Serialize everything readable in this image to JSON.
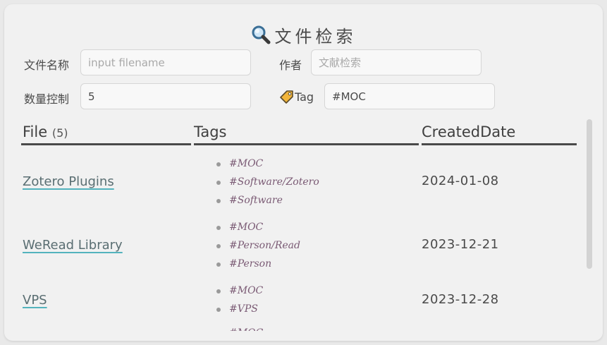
{
  "search": {
    "title": "文件检索",
    "filename_label": "文件名称",
    "filename_placeholder": "input filename",
    "filename_value": "",
    "author_label": "作者",
    "author_placeholder": "文献检索",
    "author_value": "",
    "count_label": "数量控制",
    "count_value": "5",
    "tag_label": "Tag",
    "tag_value": "#MOC"
  },
  "table": {
    "headers": {
      "file": "File",
      "file_count": "(5)",
      "tags": "Tags",
      "created": "CreatedDate"
    },
    "rows": [
      {
        "file": "Zotero Plugins",
        "tags": [
          "#MOC",
          "#Software/Zotero",
          "#Software"
        ],
        "date": "2024-01-08"
      },
      {
        "file": "WeRead Library",
        "tags": [
          "#MOC",
          "#Person/Read",
          "#Person"
        ],
        "date": "2023-12-21"
      },
      {
        "file": "VPS",
        "tags": [
          "#MOC",
          "#VPS"
        ],
        "date": "2023-12-28"
      },
      {
        "file": "",
        "tags": [
          "#MOC"
        ],
        "date": ""
      }
    ]
  },
  "icons": {
    "title_icon": "magnifier-icon",
    "tag_icon": "tag-icon"
  }
}
